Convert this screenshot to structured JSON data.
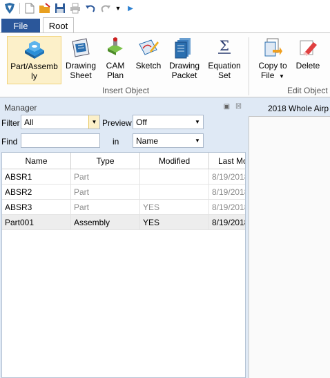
{
  "quick_access": {
    "icons": [
      "app-icon",
      "new-icon",
      "open-icon",
      "save-icon",
      "print-icon",
      "undo-icon",
      "redo-icon",
      "customize-icon",
      "more-icon"
    ]
  },
  "tabs": {
    "file": "File",
    "root": "Root"
  },
  "ribbon": {
    "buttons": [
      {
        "label1": "Part/Assemb",
        "label2": "ly"
      },
      {
        "label1": "Drawing",
        "label2": "Sheet"
      },
      {
        "label1": "CAM",
        "label2": "Plan"
      },
      {
        "label1": "Sketch",
        "label2": ""
      },
      {
        "label1": "Drawing",
        "label2": "Packet"
      },
      {
        "label1": "Equation",
        "label2": "Set"
      },
      {
        "label1": "Copy to",
        "label2": "File"
      },
      {
        "label1": "Delete",
        "label2": ""
      }
    ],
    "groups": {
      "insert": "Insert Object",
      "edit": "Edit Object"
    }
  },
  "manager": {
    "title": "Manager",
    "filter_label": "Filter",
    "filter_value": "All",
    "preview_label": "Preview",
    "preview_value": "Off",
    "find_label": "Find",
    "find_value": "",
    "in_label": "in",
    "in_value": "Name",
    "columns": [
      "Name",
      "Type",
      "Modified",
      "Last Mo"
    ],
    "rows": [
      {
        "name": "ABSR1",
        "type": "Part",
        "modified": "",
        "last": "8/19/2018"
      },
      {
        "name": "ABSR2",
        "type": "Part",
        "modified": "",
        "last": "8/19/2018"
      },
      {
        "name": "ABSR3",
        "type": "Part",
        "modified": "YES",
        "last": "8/19/2018"
      },
      {
        "name": "Part001",
        "type": "Assembly",
        "modified": "YES",
        "last": "8/19/2018"
      }
    ]
  },
  "document": {
    "tab_title": "2018 Whole Airp"
  },
  "colors": {
    "file_tab": "#2b579a",
    "panel_bg": "#dfe9f5",
    "selected_button": "#fcf0c9"
  }
}
